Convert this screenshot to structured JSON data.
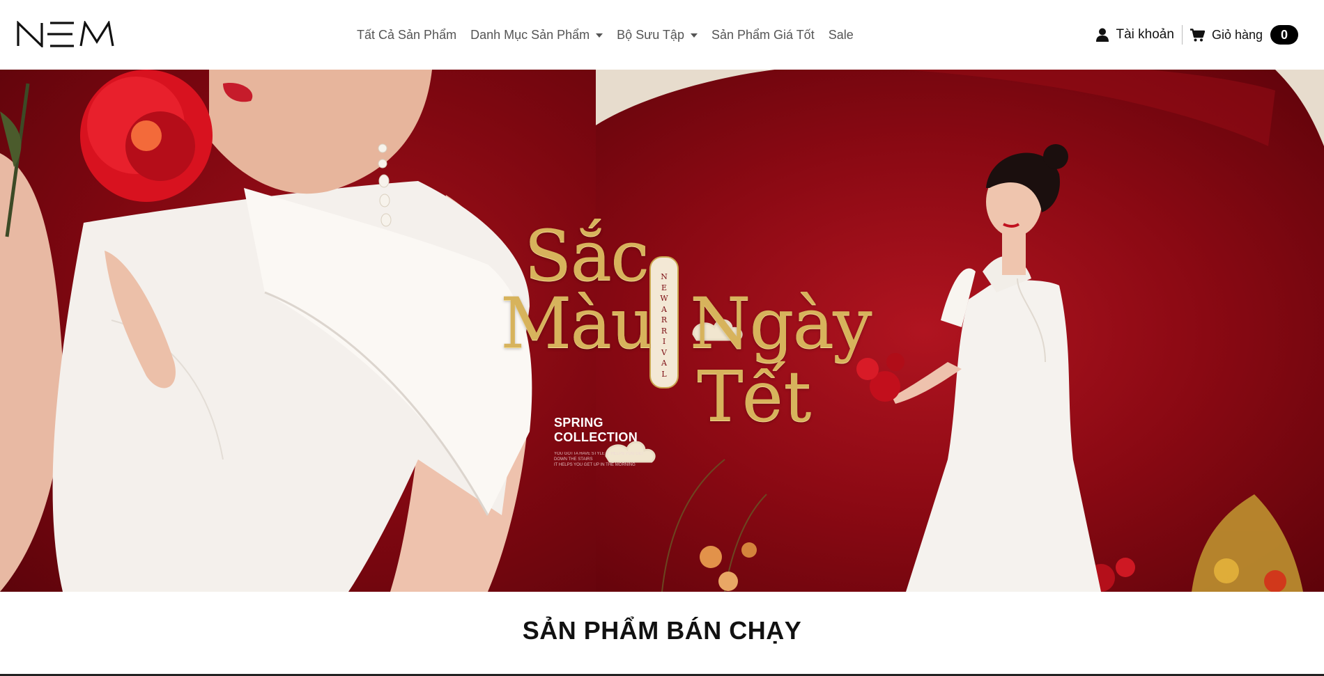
{
  "brand": {
    "logo_text": "NEM"
  },
  "nav": {
    "items": [
      {
        "label": "Tất Cả Sản Phẩm",
        "has_caret": false
      },
      {
        "label": "Danh Mục Sản Phẩm",
        "has_caret": true
      },
      {
        "label": "Bộ Sưu Tập",
        "has_caret": true
      },
      {
        "label": "Sản Phẩm Giá Tốt",
        "has_caret": false
      },
      {
        "label": "Sale",
        "has_caret": false
      }
    ]
  },
  "header_right": {
    "account_label": "Tài khoản",
    "account_icon": "user-icon",
    "cart_label": "Giỏ hàng",
    "cart_icon": "cart-icon",
    "cart_count": "0"
  },
  "hero": {
    "title_words": [
      "Sắc",
      "Màu",
      "Ngày",
      "Tết"
    ],
    "plaque_text": "NEWARRIVAL",
    "collection_line1": "SPRING",
    "collection_line2": "COLLECTION",
    "small_lines": [
      "YOU GOTTA HAVE STYLE IT HELPS YOU GET",
      "DOWN THE STAIRS",
      "IT HELPS YOU GET UP IN THE MORNING"
    ],
    "accent_color": "#d7b35c",
    "background_color": "#8a0913"
  },
  "section": {
    "title": "SẢN PHẨM BÁN CHẠY"
  }
}
